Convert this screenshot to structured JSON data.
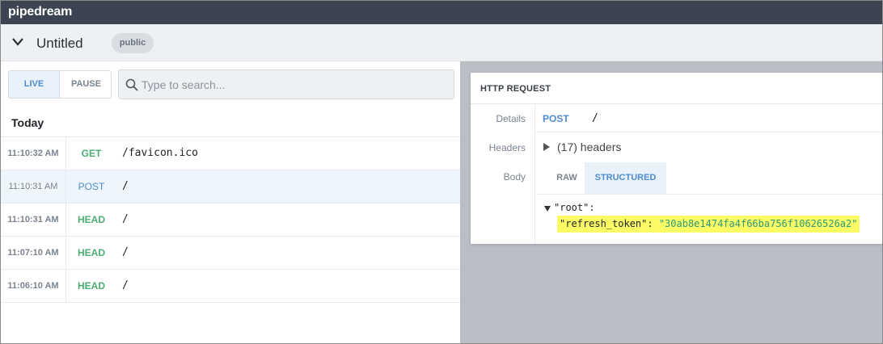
{
  "app": {
    "brand": "pipedream"
  },
  "source": {
    "title": "Untitled",
    "visibility": "public"
  },
  "controls": {
    "live_label": "LIVE",
    "pause_label": "PAUSE",
    "search_placeholder": "Type to search..."
  },
  "events": {
    "group_label": "Today",
    "rows": [
      {
        "time": "11:10:32 AM",
        "method": "GET",
        "path": "/favicon.ico"
      },
      {
        "time": "11:10:31 AM",
        "method": "POST",
        "path": "/"
      },
      {
        "time": "11:10:31 AM",
        "method": "HEAD",
        "path": "/"
      },
      {
        "time": "11:07:10 AM",
        "method": "HEAD",
        "path": "/"
      },
      {
        "time": "11:06:10 AM",
        "method": "HEAD",
        "path": "/"
      }
    ]
  },
  "detail": {
    "title": "HTTP REQUEST",
    "labels": {
      "details": "Details",
      "headers": "Headers",
      "body": "Body"
    },
    "method": "POST",
    "path": "/",
    "headers_summary": "(17) headers",
    "body_tabs": {
      "raw": "RAW",
      "structured": "STRUCTURED"
    },
    "json": {
      "root": "\"root\":",
      "key": "\"refresh_token\":",
      "value": "\"30ab8e1474fa4f66ba756f10626526a2\""
    }
  },
  "colors": {
    "get": "#4cae72",
    "head": "#4cae72",
    "post": "#4f8ccd",
    "topbar": "#3c4451",
    "highlight": "#fbfb66"
  }
}
